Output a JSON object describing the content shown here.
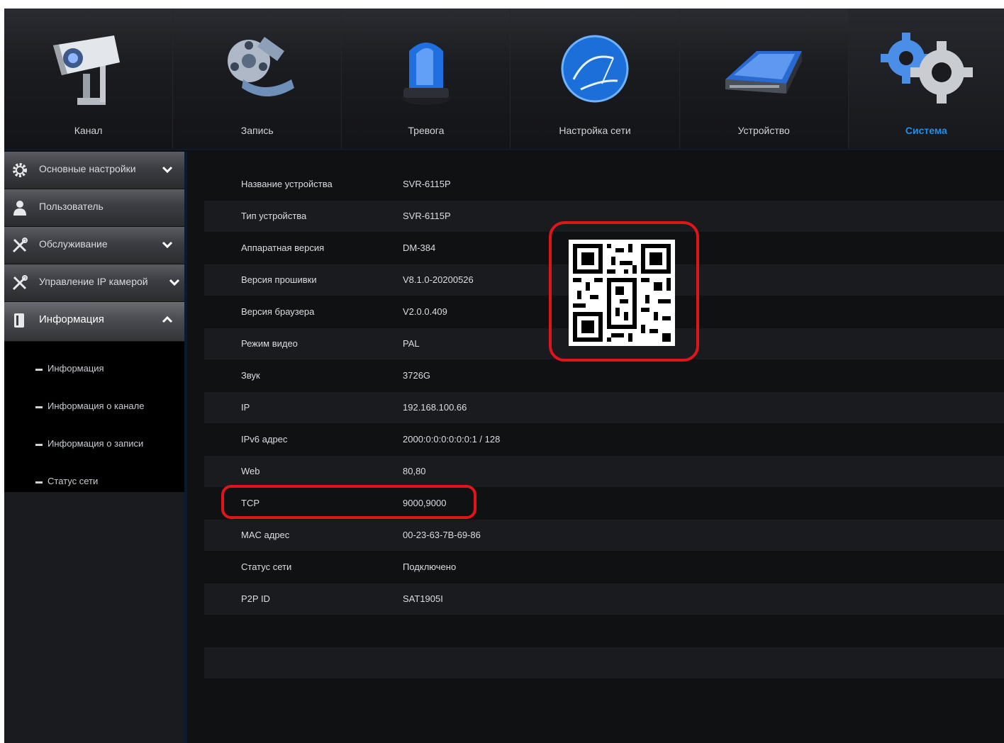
{
  "nav": {
    "tabs": [
      {
        "label": "Канал",
        "icon": "camera-icon"
      },
      {
        "label": "Запись",
        "icon": "film-reel-icon"
      },
      {
        "label": "Тревога",
        "icon": "alarm-beacon-icon"
      },
      {
        "label": "Настройка сети",
        "icon": "network-globe-icon"
      },
      {
        "label": "Устройство",
        "icon": "hard-drive-icon"
      },
      {
        "label": "Система",
        "icon": "gears-icon"
      }
    ],
    "active_tab": "Система",
    "active_color": "#1f8fe8"
  },
  "sidebar": {
    "menu": [
      {
        "label": "Основные настройки",
        "icon": "gear-icon",
        "expandable": true
      },
      {
        "label": "Пользователь",
        "icon": "user-icon",
        "expandable": false
      },
      {
        "label": "Обслуживание",
        "icon": "tools-icon",
        "expandable": true
      },
      {
        "label": "Управление IP камерой",
        "icon": "tools-icon",
        "expandable": true
      },
      {
        "label": "Информация",
        "icon": "info-book-icon",
        "expandable": true,
        "expanded": true
      }
    ],
    "submenu": [
      {
        "label": "Информация"
      },
      {
        "label": "Информация о канале"
      },
      {
        "label": "Информация о записи"
      },
      {
        "label": "Статус сети"
      }
    ]
  },
  "info": {
    "rows": [
      {
        "key": "Название устройства",
        "value": "SVR-6115P"
      },
      {
        "key": "Тип устройства",
        "value": "SVR-6115P"
      },
      {
        "key": "Аппаратная версия",
        "value": "DM-384"
      },
      {
        "key": "Версия прошивки",
        "value": "V8.1.0-20200526"
      },
      {
        "key": "Версия браузера",
        "value": "V2.0.0.409"
      },
      {
        "key": "Режим видео",
        "value": "PAL"
      },
      {
        "key": "Звук",
        "value": "3726G"
      },
      {
        "key": "IP",
        "value": "192.168.100.66"
      },
      {
        "key": "IPv6 адрес",
        "value": "2000:0:0:0:0:0:0:1 / 128"
      },
      {
        "key": "Web",
        "value": "80,80"
      },
      {
        "key": "TCP",
        "value": "9000,9000"
      },
      {
        "key": "MAC адрес",
        "value": "00-23-63-7B-69-86"
      },
      {
        "key": "Статус сети",
        "value": "Подключено"
      },
      {
        "key": "P2P ID",
        "value": "SAT1905I"
      },
      {
        "key": "",
        "value": ""
      },
      {
        "key": "",
        "value": ""
      }
    ]
  },
  "highlights": {
    "color": "#e0141b"
  }
}
